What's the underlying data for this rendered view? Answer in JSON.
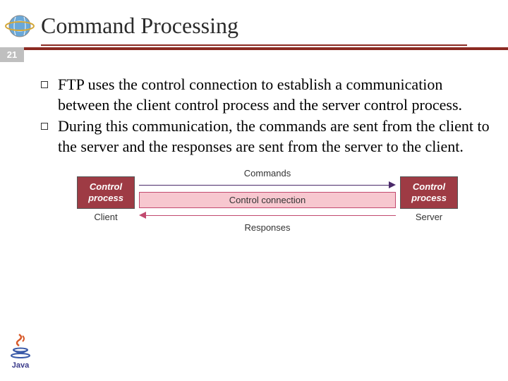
{
  "slide": {
    "title": "Command Processing",
    "page_number": "21"
  },
  "bullets": [
    "FTP uses the control connection to establish a communication between the client control process and the server control process.",
    "During this communication, the commands are sent from the client to the server and the responses are sent from the server to the client."
  ],
  "diagram": {
    "left_box": "Control process",
    "left_label": "Client",
    "right_box": "Control process",
    "right_label": "Server",
    "top_arrow_label": "Commands",
    "connection_label": "Control connection",
    "bottom_arrow_label": "Responses"
  },
  "logo": {
    "java": "Java"
  }
}
